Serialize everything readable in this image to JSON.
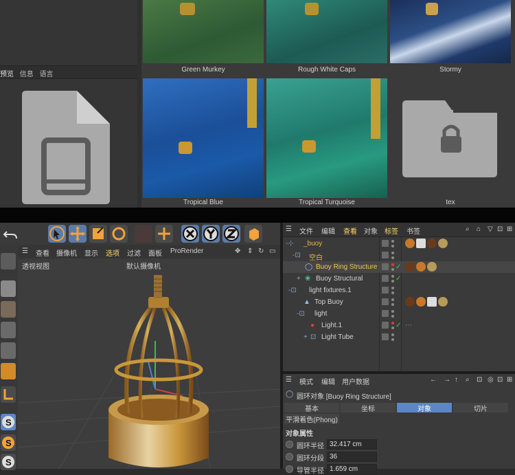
{
  "browser": {
    "left_tabs": [
      "预览",
      "信息",
      "语言"
    ],
    "thumbnails": [
      {
        "label": "Green Murkey",
        "color": "#3f6a3a"
      },
      {
        "label": "Rough White Caps",
        "color": "#2f7a6a"
      },
      {
        "label": "Stormy",
        "color": "#1d3a6a"
      },
      {
        "label": "Tropical Blue",
        "color": "#1f5aa8"
      },
      {
        "label": "Tropical Turquoise",
        "color": "#2a8a7a"
      },
      {
        "label": "tex",
        "color": "#3a3a3a"
      }
    ]
  },
  "viewport": {
    "menu": [
      "查看",
      "摄像机",
      "显示",
      "选项",
      "过滤",
      "面板",
      "ProRender"
    ],
    "highlighted_menu": "选项",
    "view_label": "透视视图",
    "camera_label": "默认摄像机"
  },
  "object_manager": {
    "menu": [
      "文件",
      "编辑",
      "查看",
      "对象",
      "标签",
      "书签"
    ],
    "highlighted_menu": [
      "查看",
      "标签"
    ],
    "rows": [
      {
        "label": "_buoy",
        "indent": 0,
        "color": "orange",
        "check": "none"
      },
      {
        "label": "空白",
        "indent": 1,
        "color": "orange",
        "check": "none"
      },
      {
        "label": "Buoy Ring Structure",
        "indent": 2,
        "color": "yellow",
        "check": "green"
      },
      {
        "label": "Buoy Structural",
        "indent": 2,
        "color": "normal",
        "check": "green"
      },
      {
        "label": "light fixtures.1",
        "indent": 1,
        "color": "normal",
        "check": "none"
      },
      {
        "label": "Top Buoy",
        "indent": 2,
        "color": "normal",
        "check": "none"
      },
      {
        "label": "light",
        "indent": 1,
        "color": "normal",
        "check": "none"
      },
      {
        "label": "Light.1",
        "indent": 2,
        "color": "normal",
        "check": "green"
      },
      {
        "label": "Light Tube",
        "indent": 2,
        "color": "normal",
        "check": "none"
      }
    ]
  },
  "attribute_manager": {
    "menu": [
      "模式",
      "编辑",
      "用户数据"
    ],
    "title": "圆环对象 [Buoy Ring Structure]",
    "tabs": [
      "基本",
      "坐标",
      "对象",
      "切片"
    ],
    "active_tab": "对象",
    "phong_tab": "平滑着色(Phong)",
    "section": "对象属性",
    "fields": [
      {
        "label": "圆环半径",
        "value": "32.417 cm"
      },
      {
        "label": "圆环分段",
        "value": "36"
      },
      {
        "label": "导管半径",
        "value": "1.659 cm"
      }
    ]
  }
}
